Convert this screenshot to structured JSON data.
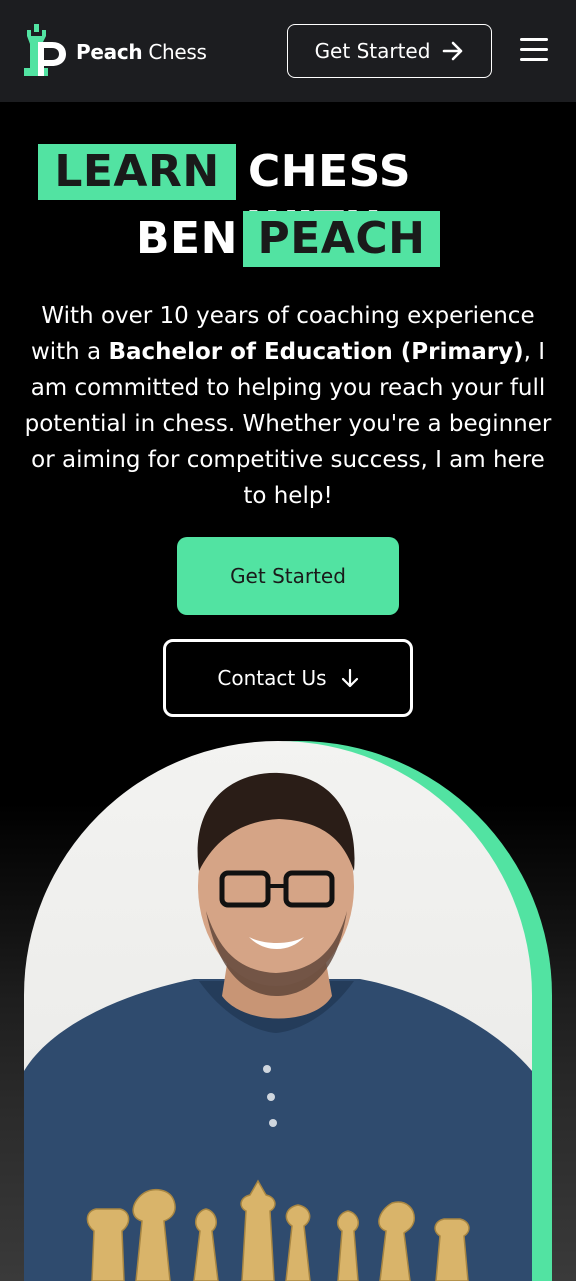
{
  "header": {
    "brand_bold": "Peach",
    "brand_regular": "Chess",
    "get_started_label": "Get Started",
    "logo_icon": "rook-p-logo-icon",
    "menu_icon": "hamburger-menu-icon"
  },
  "hero": {
    "title_word_1": "LEARN",
    "title_word_2": "CHESS WITH",
    "title_word_3": "BEN",
    "title_word_4": "PEACH",
    "intro_before": "With over 10 years of coaching experience with a ",
    "intro_bold": "Bachelor of Education (Primary)",
    "intro_after": ", I am committed to helping you reach your full potential in chess. Whether you're a beginner or aiming for competitive success, I am here to help!",
    "cta_label": "Get Started",
    "contact_label": "Contact Us"
  },
  "colors": {
    "accent": "#52e3a2",
    "header_bg": "#1c1d20",
    "page_bg": "#000000"
  }
}
